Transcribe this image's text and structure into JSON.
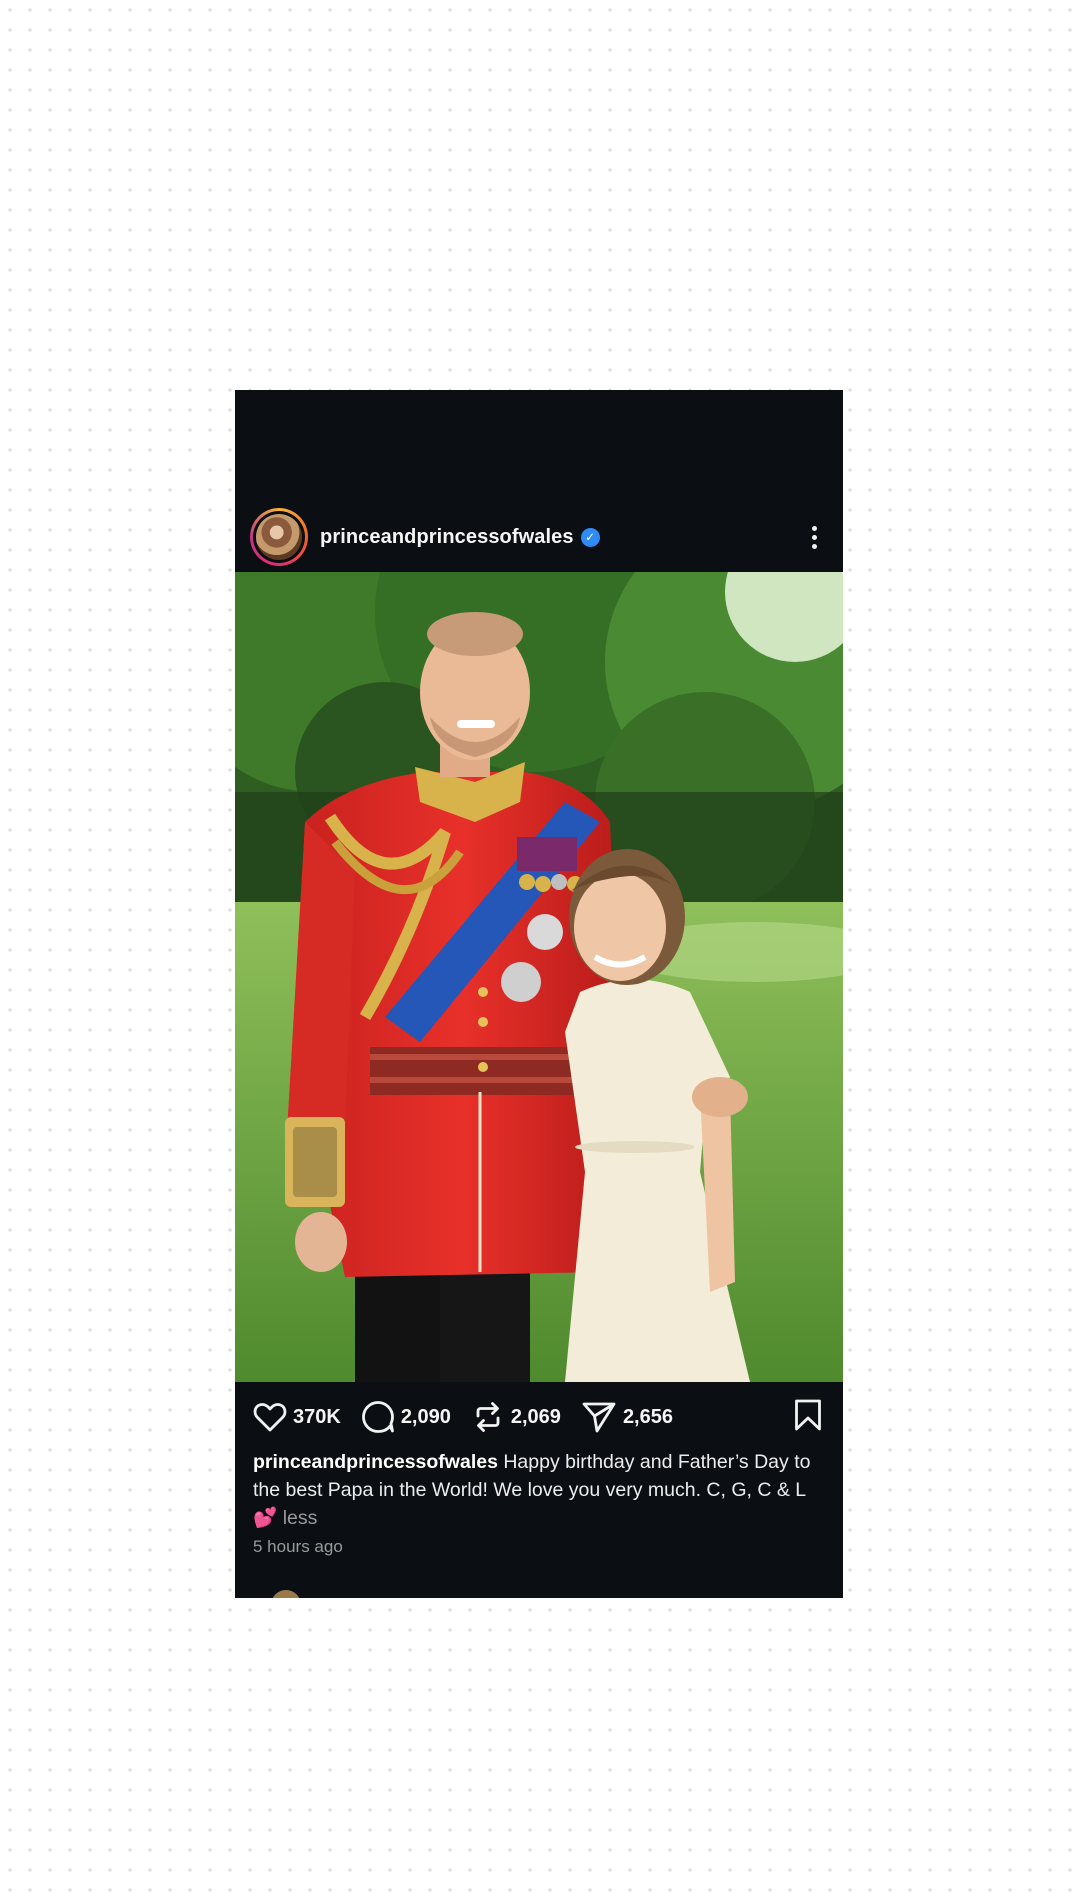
{
  "post": {
    "username": "princeandprincessofwales",
    "verified_icon": "verified-badge-icon",
    "more_icon": "more-vertical-icon",
    "image_alt": "Man in red ceremonial military uniform with medals and gold aiguillettes standing with a young girl in a white dress in a garden",
    "actions": {
      "likes": "370K",
      "comments": "2,090",
      "reposts": "2,069",
      "shares": "2,656"
    },
    "caption": {
      "user": "princeandprincessofwales",
      "text": "Happy birthday and Father’s Day to the best Papa in the World! We love you very much. C, G, C & L",
      "emoji": "💕",
      "toggle": "less"
    },
    "timestamp": "5 hours ago"
  },
  "colors": {
    "card_background": "#0b0f13",
    "verified": "#2f8bf5",
    "heart_emoji": "#ff4fa3"
  }
}
